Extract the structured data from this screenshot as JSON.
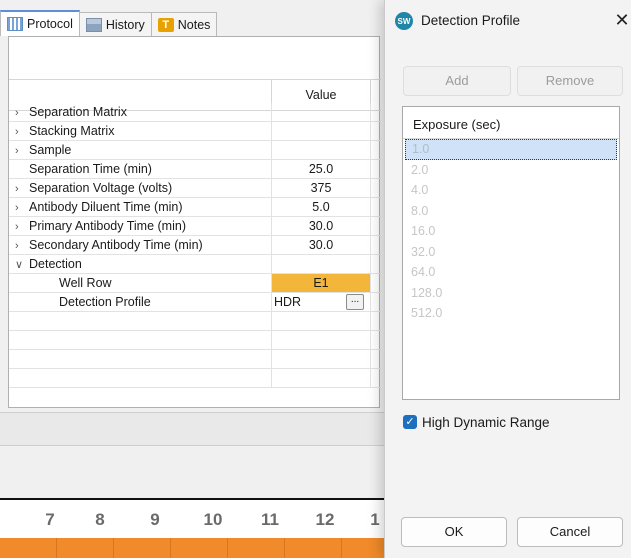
{
  "tabs": [
    {
      "label": "Protocol",
      "icon": "grid-icon",
      "active": true
    },
    {
      "label": "History",
      "icon": "history-icon",
      "active": false
    },
    {
      "label": "Notes",
      "icon": "notes-icon",
      "active": false
    }
  ],
  "grid": {
    "value_header": "Value",
    "rows": [
      {
        "name": "Separation Matrix",
        "value": "",
        "expandable": true,
        "expanded": false
      },
      {
        "name": "Stacking Matrix",
        "value": "",
        "expandable": true,
        "expanded": false
      },
      {
        "name": "Sample",
        "value": "",
        "expandable": true,
        "expanded": false
      },
      {
        "name": "Separation Time (min)",
        "value": "25.0",
        "expandable": false
      },
      {
        "name": "Separation Voltage (volts)",
        "value": "375",
        "expandable": true,
        "expanded": false
      },
      {
        "name": "Antibody Diluent Time (min)",
        "value": "5.0",
        "expandable": true,
        "expanded": false
      },
      {
        "name": "Primary Antibody Time (min)",
        "value": "30.0",
        "expandable": true,
        "expanded": false
      },
      {
        "name": "Secondary Antibody Time (min)",
        "value": "30.0",
        "expandable": true,
        "expanded": false
      },
      {
        "name": "Detection",
        "value": "",
        "expandable": true,
        "expanded": true
      },
      {
        "name": "Well Row",
        "value": "E1",
        "child": true,
        "highlight": true
      },
      {
        "name": "Detection Profile",
        "value": "HDR",
        "child": true,
        "ellipsis": "..."
      }
    ]
  },
  "ruler_numbers": [
    "7",
    "8",
    "9",
    "10",
    "11",
    "12",
    "1"
  ],
  "dialog": {
    "title": "Detection Profile",
    "logo_text": "SW",
    "close_glyph": "✕",
    "add_label": "Add",
    "remove_label": "Remove",
    "list_header": "Exposure (sec)",
    "exposures": [
      "1.0",
      "2.0",
      "4.0",
      "8.0",
      "16.0",
      "32.0",
      "64.0",
      "128.0",
      "512.0"
    ],
    "selected_index": 0,
    "hdr_label": "High Dynamic Range",
    "hdr_checked": true,
    "ok_label": "OK",
    "cancel_label": "Cancel"
  },
  "colors": {
    "highlight": "#f4b63a",
    "accent": "#1f6fbf",
    "timeline": "#f08a2a"
  }
}
